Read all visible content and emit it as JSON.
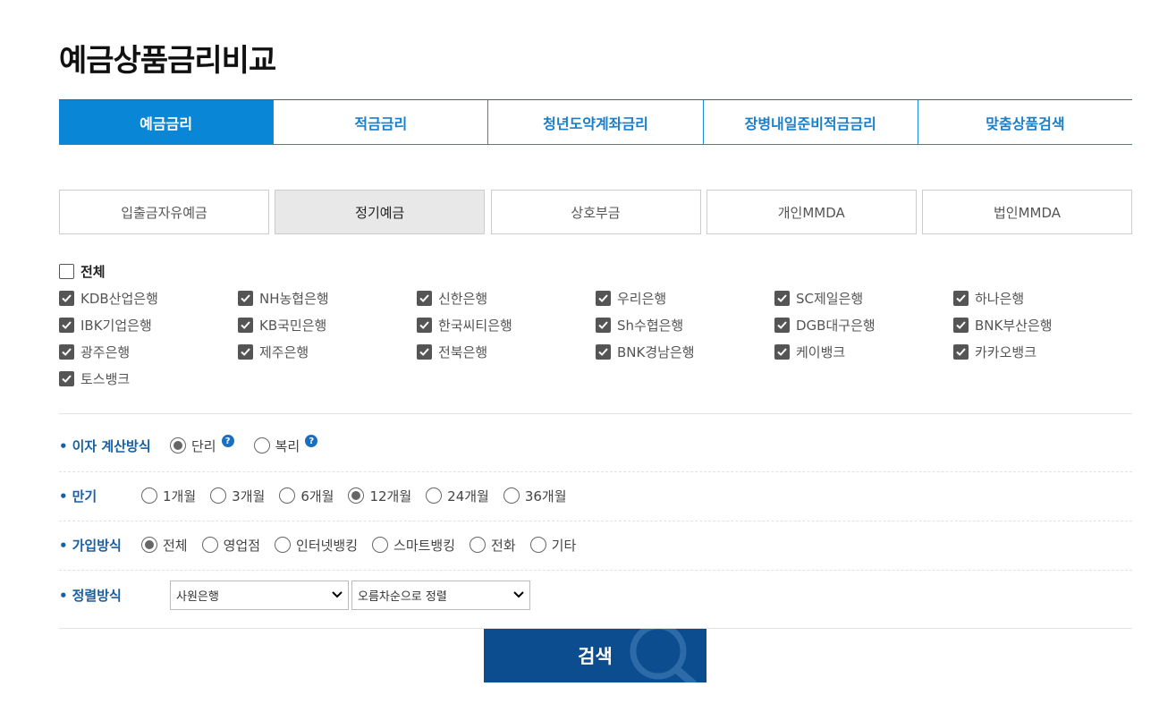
{
  "page_title": "예금상품금리비교",
  "main_tabs": [
    {
      "label": "예금금리",
      "active": true
    },
    {
      "label": "적금금리",
      "active": false
    },
    {
      "label": "청년도약계좌금리",
      "active": false
    },
    {
      "label": "장병내일준비적금금리",
      "active": false
    },
    {
      "label": "맞춤상품검색",
      "active": false
    }
  ],
  "sub_tabs": [
    {
      "label": "입출금자유예금",
      "active": false
    },
    {
      "label": "정기예금",
      "active": true
    },
    {
      "label": "상호부금",
      "active": false
    },
    {
      "label": "개인MMDA",
      "active": false
    },
    {
      "label": "법인MMDA",
      "active": false
    }
  ],
  "select_all": {
    "label": "전체",
    "checked": false
  },
  "banks": [
    "KDB산업은행",
    "NH농협은행",
    "신한은행",
    "우리은행",
    "SC제일은행",
    "하나은행",
    "IBK기업은행",
    "KB국민은행",
    "한국씨티은행",
    "Sh수협은행",
    "DGB대구은행",
    "BNK부산은행",
    "광주은행",
    "제주은행",
    "전북은행",
    "BNK경남은행",
    "케이뱅크",
    "카카오뱅크",
    "토스뱅크"
  ],
  "interest_method": {
    "label": "이자 계산방식",
    "options": [
      "단리",
      "복리"
    ],
    "selected": 0
  },
  "term": {
    "label": "만기",
    "options": [
      "1개월",
      "3개월",
      "6개월",
      "12개월",
      "24개월",
      "36개월"
    ],
    "selected": 3
  },
  "join_method": {
    "label": "가입방식",
    "options": [
      "전체",
      "영업점",
      "인터넷뱅킹",
      "스마트뱅킹",
      "전화",
      "기타"
    ],
    "selected": 0
  },
  "sort": {
    "label": "정렬방식",
    "select1": "사원은행",
    "select2": "오름차순으로 정렬"
  },
  "search_button": "검색",
  "help_glyph": "?",
  "icons": {
    "check": "check-icon",
    "help": "question-circle-icon",
    "dropdown": "chevron-down-icon",
    "search": "magnifier-icon"
  },
  "colors": {
    "primary": "#0a86d6",
    "navy": "#0c4d8f",
    "label": "#1a5fa0"
  }
}
